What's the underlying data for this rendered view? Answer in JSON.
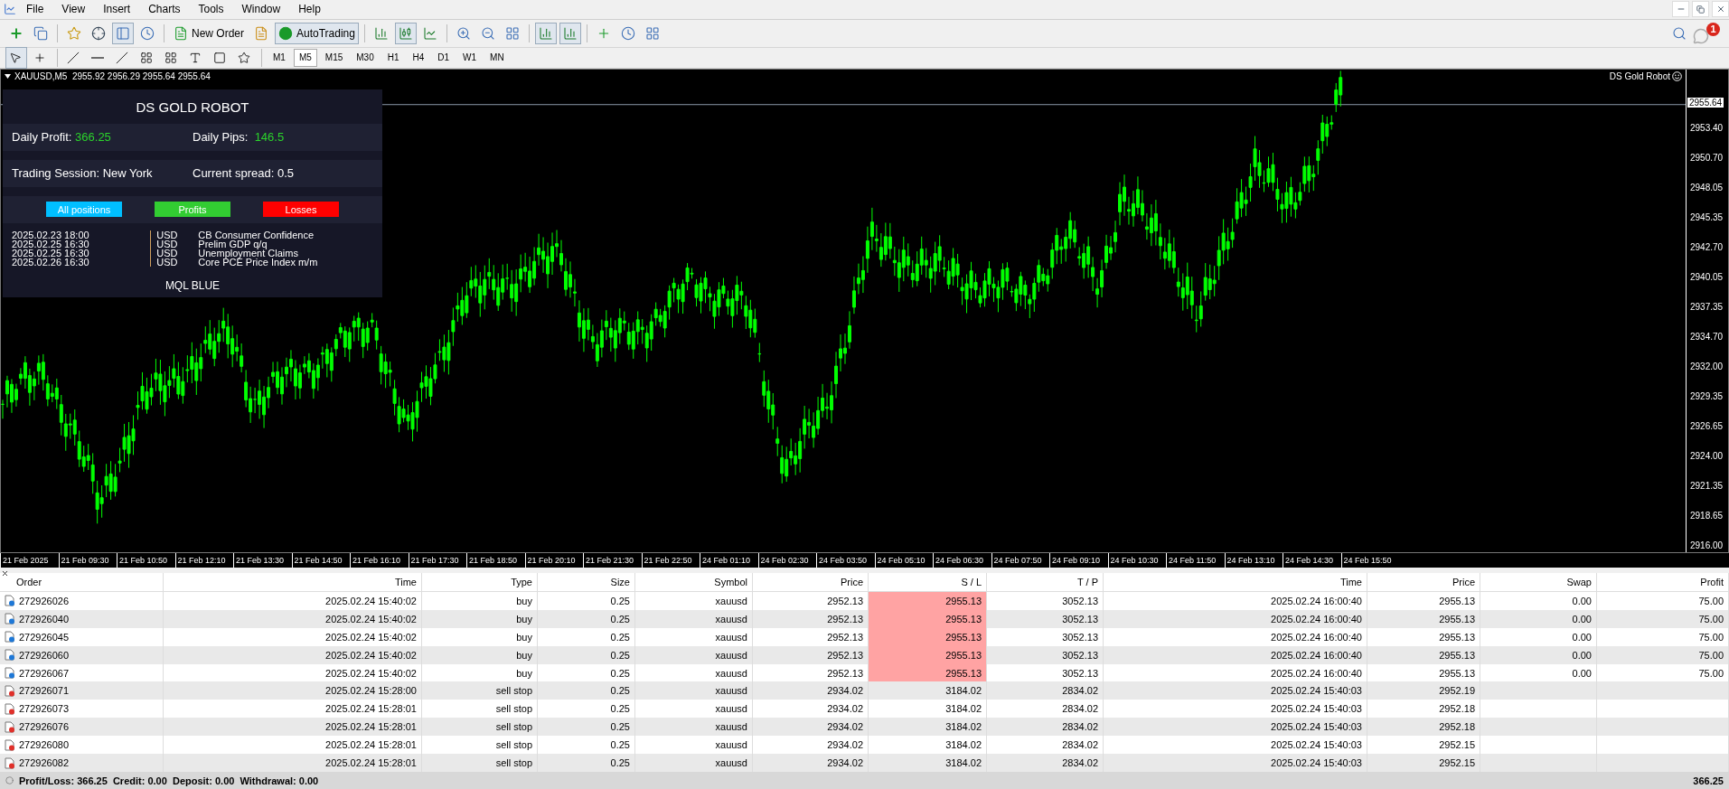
{
  "menu": [
    "File",
    "View",
    "Insert",
    "Charts",
    "Tools",
    "Window",
    "Help"
  ],
  "toolbar": {
    "new_order": "New Order",
    "autotrading": {
      "label": "AutoTrading",
      "on": true
    },
    "notifications_badge": "1"
  },
  "timeframes": [
    {
      "label": "M1",
      "selected": false
    },
    {
      "label": "M5",
      "selected": true
    },
    {
      "label": "M15",
      "selected": false
    },
    {
      "label": "M30",
      "selected": false
    },
    {
      "label": "H1",
      "selected": false
    },
    {
      "label": "H4",
      "selected": false
    },
    {
      "label": "D1",
      "selected": false
    },
    {
      "label": "W1",
      "selected": false
    },
    {
      "label": "MN",
      "selected": false
    }
  ],
  "chart": {
    "header": "XAUUSD,M5  2955.92 2956.29 2955.64 2955.64",
    "expert": "DS Gold Robot",
    "current_price": "2955.64",
    "price_axis": [
      "2953.40",
      "2950.70",
      "2948.05",
      "2945.35",
      "2942.70",
      "2940.05",
      "2937.35",
      "2934.70",
      "2932.00",
      "2929.35",
      "2926.65",
      "2924.00",
      "2921.35",
      "2918.65",
      "2916.00"
    ],
    "time_axis": [
      "21 Feb 2025",
      "21 Feb 09:30",
      "21 Feb 10:50",
      "21 Feb 12:10",
      "21 Feb 13:30",
      "21 Feb 14:50",
      "21 Feb 16:10",
      "21 Feb 17:30",
      "21 Feb 18:50",
      "21 Feb 20:10",
      "21 Feb 21:30",
      "21 Feb 22:50",
      "24 Feb 01:10",
      "24 Feb 02:30",
      "24 Feb 03:50",
      "24 Feb 05:10",
      "24 Feb 06:30",
      "24 Feb 07:50",
      "24 Feb 09:10",
      "24 Feb 10:30",
      "24 Feb 11:50",
      "24 Feb 13:10",
      "24 Feb 14:30",
      "24 Feb 15:50"
    ]
  },
  "panel": {
    "title": "DS GOLD ROBOT",
    "stats": [
      [
        {
          "label": "Daily Profit: ",
          "value": "366.25"
        },
        {
          "label": "Daily Pips:  ",
          "value": "146.5"
        }
      ],
      [
        {
          "label": "Trading Session: New York"
        },
        {
          "label": "Current spread: 0.5"
        }
      ]
    ],
    "buttons": [
      {
        "label": "All positions",
        "color": "#00bfff"
      },
      {
        "label": "Profits",
        "color": "#32cd32"
      },
      {
        "label": "Losses",
        "color": "#ff0000"
      }
    ],
    "news": [
      {
        "time": "2025.02.23 18:00",
        "currency": "USD",
        "event": "CB Consumer Confidence"
      },
      {
        "time": "2025.02.25 16:30",
        "currency": "USD",
        "event": "Prelim GDP q/q"
      },
      {
        "time": "2025.02.25 16:30",
        "currency": "USD",
        "event": "Unemployment Claims"
      },
      {
        "time": "2025.02.26 16:30",
        "currency": "USD",
        "event": "Core PCE Price Index m/m"
      }
    ],
    "footer": "MQL BLUE"
  },
  "table": {
    "columns": [
      "Order",
      "Time",
      "Type",
      "Size",
      "Symbol",
      "Price",
      "S / L",
      "T / P",
      "Time",
      "Price",
      "Swap",
      "Profit"
    ],
    "rows": [
      {
        "kind": "market",
        "order": "272926026",
        "time": "2025.02.24 15:40:02",
        "type": "buy",
        "size": "0.25",
        "symbol": "xauusd",
        "price": "2952.13",
        "sl": "2955.13",
        "sl_highlight": true,
        "tp": "3052.13",
        "time2": "2025.02.24 16:00:40",
        "price2": "2955.13",
        "swap": "0.00",
        "profit": "75.00"
      },
      {
        "kind": "market",
        "order": "272926040",
        "time": "2025.02.24 15:40:02",
        "type": "buy",
        "size": "0.25",
        "symbol": "xauusd",
        "price": "2952.13",
        "sl": "2955.13",
        "sl_highlight": true,
        "tp": "3052.13",
        "time2": "2025.02.24 16:00:40",
        "price2": "2955.13",
        "swap": "0.00",
        "profit": "75.00"
      },
      {
        "kind": "market",
        "order": "272926045",
        "time": "2025.02.24 15:40:02",
        "type": "buy",
        "size": "0.25",
        "symbol": "xauusd",
        "price": "2952.13",
        "sl": "2955.13",
        "sl_highlight": true,
        "tp": "3052.13",
        "time2": "2025.02.24 16:00:40",
        "price2": "2955.13",
        "swap": "0.00",
        "profit": "75.00"
      },
      {
        "kind": "market",
        "order": "272926060",
        "time": "2025.02.24 15:40:02",
        "type": "buy",
        "size": "0.25",
        "symbol": "xauusd",
        "price": "2952.13",
        "sl": "2955.13",
        "sl_highlight": true,
        "tp": "3052.13",
        "time2": "2025.02.24 16:00:40",
        "price2": "2955.13",
        "swap": "0.00",
        "profit": "75.00"
      },
      {
        "kind": "market",
        "order": "272926067",
        "time": "2025.02.24 15:40:02",
        "type": "buy",
        "size": "0.25",
        "symbol": "xauusd",
        "price": "2952.13",
        "sl": "2955.13",
        "sl_highlight": true,
        "tp": "3052.13",
        "time2": "2025.02.24 16:00:40",
        "price2": "2955.13",
        "swap": "0.00",
        "profit": "75.00"
      },
      {
        "kind": "pending",
        "order": "272926071",
        "time": "2025.02.24 15:28:00",
        "type": "sell stop",
        "size": "0.25",
        "symbol": "xauusd",
        "price": "2934.02",
        "sl": "3184.02",
        "sl_highlight": false,
        "tp": "2834.02",
        "time2": "2025.02.24 15:40:03",
        "price2": "2952.19"
      },
      {
        "kind": "pending",
        "order": "272926073",
        "time": "2025.02.24 15:28:01",
        "type": "sell stop",
        "size": "0.25",
        "symbol": "xauusd",
        "price": "2934.02",
        "sl": "3184.02",
        "sl_highlight": false,
        "tp": "2834.02",
        "time2": "2025.02.24 15:40:03",
        "price2": "2952.18"
      },
      {
        "kind": "pending",
        "order": "272926076",
        "time": "2025.02.24 15:28:01",
        "type": "sell stop",
        "size": "0.25",
        "symbol": "xauusd",
        "price": "2934.02",
        "sl": "3184.02",
        "sl_highlight": false,
        "tp": "2834.02",
        "time2": "2025.02.24 15:40:03",
        "price2": "2952.18"
      },
      {
        "kind": "pending",
        "order": "272926080",
        "time": "2025.02.24 15:28:01",
        "type": "sell stop",
        "size": "0.25",
        "symbol": "xauusd",
        "price": "2934.02",
        "sl": "3184.02",
        "sl_highlight": false,
        "tp": "2834.02",
        "time2": "2025.02.24 15:40:03",
        "price2": "2952.15"
      },
      {
        "kind": "pending",
        "order": "272926082",
        "time": "2025.02.24 15:28:01",
        "type": "sell stop",
        "size": "0.25",
        "symbol": "xauusd",
        "price": "2934.02",
        "sl": "3184.02",
        "sl_highlight": false,
        "tp": "2834.02",
        "time2": "2025.02.24 15:40:03",
        "price2": "2952.15"
      }
    ]
  },
  "status_bar": {
    "summary": "Profit/Loss: 366.25  Credit: 0.00  Deposit: 0.00  Withdrawal: 0.00",
    "total": "366.25"
  }
}
